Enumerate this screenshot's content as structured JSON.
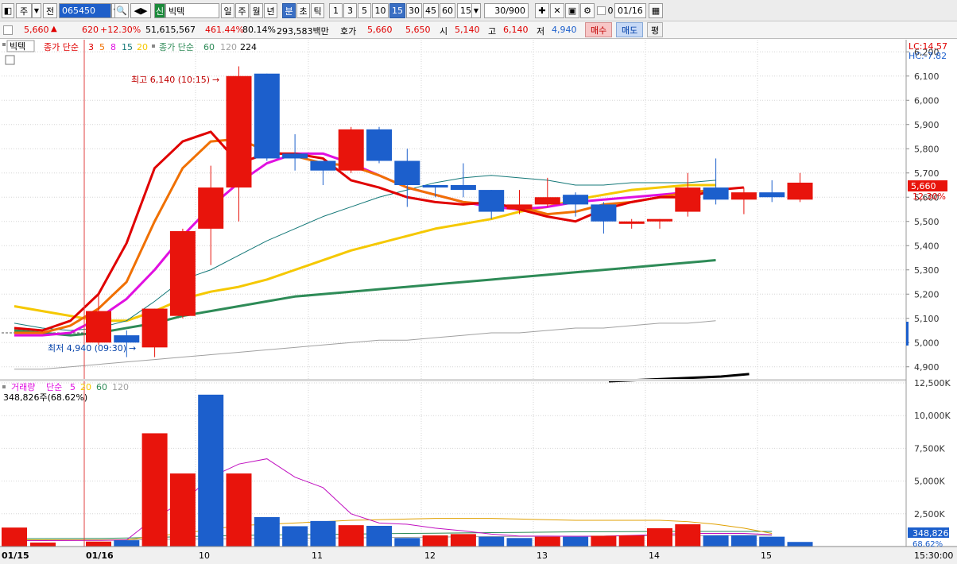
{
  "toolbar": {
    "type_label": "주",
    "all_label": "전",
    "stock_code": "065450",
    "market_badge": "신",
    "stock_name": "빅텍",
    "periods": [
      "일",
      "주",
      "월",
      "년",
      "분",
      "초",
      "틱"
    ],
    "active_period": "분",
    "intervals": [
      "1",
      "3",
      "5",
      "10",
      "15",
      "30",
      "45",
      "60"
    ],
    "active_interval": "15",
    "interval_select": "15",
    "count": "30/900",
    "checkbox_label": "0",
    "date": "01/16"
  },
  "quote": {
    "price": "5,660",
    "change": "620",
    "change_pct": "+12.30%",
    "volume": "51,615,567",
    "volume_ratio": "461.44%",
    "turnover_pct": "80.14%",
    "amount": "293,583백만",
    "bid_label": "호가",
    "ask_price": "5,660",
    "bid_price": "5,650",
    "open_label": "시",
    "open": "5,140",
    "high_label": "고",
    "high": "6,140",
    "low_label": "저",
    "low": "4,940",
    "buy_button": "매수",
    "sell_button": "매도",
    "flat_button": "평"
  },
  "price_legend": {
    "name": "빅텍",
    "ma_short_label": "종가 단순",
    "ma_short_periods": [
      "3",
      "5",
      "8",
      "15",
      "20"
    ],
    "ma_long_label": "종가 단순",
    "ma_long_periods": [
      "60",
      "120",
      "224"
    ]
  },
  "volume_legend": {
    "title": "거래량",
    "ma_label": "단순",
    "periods": [
      "5",
      "20",
      "60",
      "120"
    ],
    "current": "348,826주(68.62%)"
  },
  "annotations": {
    "high": "최고 6,140 (10:15)",
    "low": "최저 4,940 (09:30)",
    "lc": "LC:14.57",
    "hc": "HC:-7.82",
    "last_price": "5,660",
    "last_pct": "12.30%",
    "last_volume": "348,826",
    "last_volume_pct": "68.62%"
  },
  "colors": {
    "up": "#e8140c",
    "down": "#1c5fcc",
    "ma3": "#e00000",
    "ma5": "#f07000",
    "ma8": "#e010e0",
    "ma15": "#147878",
    "ma20": "#f5c800",
    "ma60": "#2e8b57",
    "ma120": "#a0a0a0",
    "ma224": "#000000"
  },
  "price_axis": {
    "ticks": [
      "6,200",
      "6,100",
      "6,000",
      "5,900",
      "5,800",
      "5,700",
      "5,600",
      "5,500",
      "5,400",
      "5,300",
      "5,200",
      "5,100",
      "5,000",
      "4,900"
    ],
    "min": 4850,
    "max": 6250
  },
  "volume_axis": {
    "ticks": [
      "12,500K",
      "10,000K",
      "7,500K",
      "5,000K",
      "2,500K"
    ],
    "max": 12500
  },
  "time_axis": {
    "labels": [
      "01/15",
      "01/16",
      "10",
      "11",
      "12",
      "13",
      "14",
      "15",
      "15:30:00"
    ]
  },
  "chart_data": {
    "type": "candlestick",
    "candles": [
      {
        "o": 5000,
        "h": 5210,
        "l": 4990,
        "c": 5130
      },
      {
        "o": 5030,
        "h": 5050,
        "l": 4940,
        "c": 5000
      },
      {
        "o": 4980,
        "h": 5140,
        "l": 4940,
        "c": 5140
      },
      {
        "o": 5110,
        "h": 5470,
        "l": 5100,
        "c": 5460
      },
      {
        "o": 5470,
        "h": 5730,
        "l": 5320,
        "c": 5640
      },
      {
        "o": 5640,
        "h": 6140,
        "l": 5500,
        "c": 6100
      },
      {
        "o": 6110,
        "h": 6110,
        "l": 5750,
        "c": 5760
      },
      {
        "o": 5780,
        "h": 5860,
        "l": 5710,
        "c": 5760
      },
      {
        "o": 5750,
        "h": 5750,
        "l": 5650,
        "c": 5710
      },
      {
        "o": 5710,
        "h": 5890,
        "l": 5700,
        "c": 5880
      },
      {
        "o": 5880,
        "h": 5890,
        "l": 5740,
        "c": 5750
      },
      {
        "o": 5750,
        "h": 5800,
        "l": 5560,
        "c": 5650
      },
      {
        "o": 5650,
        "h": 5650,
        "l": 5600,
        "c": 5640
      },
      {
        "o": 5650,
        "h": 5740,
        "l": 5600,
        "c": 5630
      },
      {
        "o": 5630,
        "h": 5630,
        "l": 5510,
        "c": 5540
      },
      {
        "o": 5550,
        "h": 5630,
        "l": 5530,
        "c": 5570
      },
      {
        "o": 5570,
        "h": 5680,
        "l": 5560,
        "c": 5600
      },
      {
        "o": 5610,
        "h": 5620,
        "l": 5520,
        "c": 5570
      },
      {
        "o": 5570,
        "h": 5580,
        "l": 5450,
        "c": 5500
      },
      {
        "o": 5490,
        "h": 5510,
        "l": 5470,
        "c": 5500
      },
      {
        "o": 5500,
        "h": 5510,
        "l": 5470,
        "c": 5510
      },
      {
        "o": 5540,
        "h": 5700,
        "l": 5520,
        "c": 5640
      },
      {
        "o": 5640,
        "h": 5760,
        "l": 5570,
        "c": 5590
      },
      {
        "o": 5590,
        "h": 5640,
        "l": 5530,
        "c": 5620
      },
      {
        "o": 5620,
        "h": 5670,
        "l": 5580,
        "c": 5600
      },
      {
        "o": 5590,
        "h": 5700,
        "l": 5580,
        "c": 5660
      }
    ],
    "pre_close": 5040,
    "volume": [
      1450,
      380,
      480,
      8650,
      5580,
      11600,
      5580,
      2250,
      1550,
      1950,
      1630,
      1580,
      650,
      850,
      950,
      750,
      650,
      750,
      750,
      820,
      850,
      1400,
      1700,
      850,
      850,
      750,
      349
    ],
    "ma3": [
      5060,
      5050,
      5090,
      5200,
      5410,
      5720,
      5830,
      5870,
      5740,
      5780,
      5780,
      5760,
      5670,
      5640,
      5600,
      5580,
      5570,
      5580,
      5550,
      5520,
      5500,
      5550,
      5580,
      5600,
      5600,
      5630,
      5640
    ],
    "ma5": [
      5040,
      5040,
      5070,
      5140,
      5250,
      5500,
      5720,
      5830,
      5840,
      5790,
      5770,
      5740,
      5730,
      5690,
      5640,
      5610,
      5580,
      5570,
      5560,
      5530,
      5540,
      5570,
      5580,
      5600,
      5620,
      5630
    ],
    "ma8": [
      5030,
      5030,
      5040,
      5100,
      5180,
      5300,
      5440,
      5560,
      5660,
      5740,
      5780,
      5780,
      5740,
      5690,
      5640,
      5610,
      5580,
      5560,
      5550,
      5560,
      5580,
      5590,
      5600,
      5610,
      5620
    ],
    "ma15": [
      5080,
      5060,
      5050,
      5060,
      5090,
      5170,
      5260,
      5300,
      5360,
      5420,
      5470,
      5520,
      5560,
      5600,
      5630,
      5660,
      5680,
      5690,
      5680,
      5670,
      5650,
      5650,
      5660,
      5660,
      5660,
      5670
    ],
    "ma20": [
      5150,
      5130,
      5110,
      5090,
      5090,
      5130,
      5180,
      5210,
      5230,
      5260,
      5300,
      5340,
      5380,
      5410,
      5440,
      5470,
      5490,
      5510,
      5540,
      5560,
      5590,
      5610,
      5630,
      5640,
      5650,
      5650
    ],
    "ma60": [
      5050,
      5040,
      5030,
      5040,
      5060,
      5080,
      5110,
      5130,
      5150,
      5170,
      5190,
      5200,
      5210,
      5220,
      5230,
      5240,
      5250,
      5260,
      5270,
      5280,
      5290,
      5300,
      5310,
      5320,
      5330,
      5340
    ],
    "ma120": [
      4890,
      4890,
      4900,
      4910,
      4920,
      4930,
      4940,
      4950,
      4960,
      4970,
      4980,
      4990,
      5000,
      5010,
      5010,
      5020,
      5030,
      5040,
      5040,
      5050,
      5060,
      5060,
      5070,
      5080,
      5080,
      5090
    ],
    "ma224": [
      4840,
      4845,
      4850,
      4855,
      4860,
      4870
    ],
    "vol_ma5": [
      450,
      470,
      500,
      2200,
      3400,
      5300,
      6300,
      6700,
      5300,
      4500,
      2500,
      1800,
      1700,
      1400,
      1200,
      950,
      800,
      800,
      780,
      790,
      850,
      920,
      1000,
      1000,
      1000,
      900
    ],
    "vol_ma20": [
      500,
      500,
      500,
      800,
      1000,
      1300,
      1600,
      1700,
      1800,
      1900,
      2000,
      2050,
      2100,
      2150,
      2150,
      2150,
      2100,
      2050,
      2000,
      2000,
      2000,
      2000,
      1900,
      1700,
      1400,
      1000
    ],
    "vol_ma60": [
      600,
      620,
      650,
      700,
      750,
      800,
      850,
      880,
      900,
      920,
      950,
      980,
      1000,
      1020,
      1040,
      1060,
      1080,
      1100,
      1120,
      1130,
      1140,
      1150,
      1150,
      1150,
      1150,
      1150
    ],
    "vol_ma120": [
      500,
      510,
      520,
      540,
      560,
      580,
      600,
      620,
      640,
      650,
      660,
      680,
      700,
      720,
      740,
      760,
      770,
      780,
      790,
      800,
      810,
      820,
      830,
      840,
      850,
      860
    ]
  }
}
